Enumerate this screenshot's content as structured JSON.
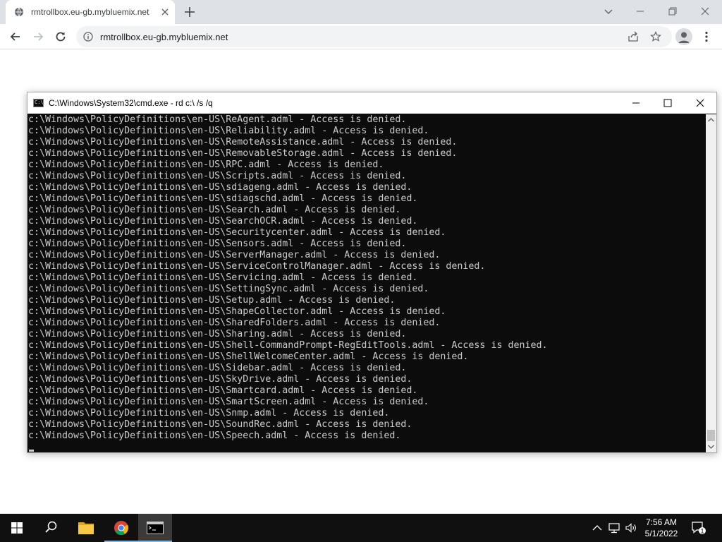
{
  "browser": {
    "tab_title": "rmtrollbox.eu-gb.mybluemix.net",
    "url": "rmtrollbox.eu-gb.mybluemix.net"
  },
  "cmd": {
    "title": "C:\\Windows\\System32\\cmd.exe - rd  c:\\ /s /q",
    "icon_text": "C:\\_",
    "lines": [
      "c:\\Windows\\PolicyDefinitions\\en-US\\ReAgent.adml - Access is denied.",
      "c:\\Windows\\PolicyDefinitions\\en-US\\Reliability.adml - Access is denied.",
      "c:\\Windows\\PolicyDefinitions\\en-US\\RemoteAssistance.adml - Access is denied.",
      "c:\\Windows\\PolicyDefinitions\\en-US\\RemovableStorage.adml - Access is denied.",
      "c:\\Windows\\PolicyDefinitions\\en-US\\RPC.adml - Access is denied.",
      "c:\\Windows\\PolicyDefinitions\\en-US\\Scripts.adml - Access is denied.",
      "c:\\Windows\\PolicyDefinitions\\en-US\\sdiageng.adml - Access is denied.",
      "c:\\Windows\\PolicyDefinitions\\en-US\\sdiagschd.adml - Access is denied.",
      "c:\\Windows\\PolicyDefinitions\\en-US\\Search.adml - Access is denied.",
      "c:\\Windows\\PolicyDefinitions\\en-US\\SearchOCR.adml - Access is denied.",
      "c:\\Windows\\PolicyDefinitions\\en-US\\Securitycenter.adml - Access is denied.",
      "c:\\Windows\\PolicyDefinitions\\en-US\\Sensors.adml - Access is denied.",
      "c:\\Windows\\PolicyDefinitions\\en-US\\ServerManager.adml - Access is denied.",
      "c:\\Windows\\PolicyDefinitions\\en-US\\ServiceControlManager.adml - Access is denied.",
      "c:\\Windows\\PolicyDefinitions\\en-US\\Servicing.adml - Access is denied.",
      "c:\\Windows\\PolicyDefinitions\\en-US\\SettingSync.adml - Access is denied.",
      "c:\\Windows\\PolicyDefinitions\\en-US\\Setup.adml - Access is denied.",
      "c:\\Windows\\PolicyDefinitions\\en-US\\ShapeCollector.adml - Access is denied.",
      "c:\\Windows\\PolicyDefinitions\\en-US\\SharedFolders.adml - Access is denied.",
      "c:\\Windows\\PolicyDefinitions\\en-US\\Sharing.adml - Access is denied.",
      "c:\\Windows\\PolicyDefinitions\\en-US\\Shell-CommandPrompt-RegEditTools.adml - Access is denied.",
      "c:\\Windows\\PolicyDefinitions\\en-US\\ShellWelcomeCenter.adml - Access is denied.",
      "c:\\Windows\\PolicyDefinitions\\en-US\\Sidebar.adml - Access is denied.",
      "c:\\Windows\\PolicyDefinitions\\en-US\\SkyDrive.adml - Access is denied.",
      "c:\\Windows\\PolicyDefinitions\\en-US\\Smartcard.adml - Access is denied.",
      "c:\\Windows\\PolicyDefinitions\\en-US\\SmartScreen.adml - Access is denied.",
      "c:\\Windows\\PolicyDefinitions\\en-US\\Snmp.adml - Access is denied.",
      "c:\\Windows\\PolicyDefinitions\\en-US\\SoundRec.adml - Access is denied.",
      "c:\\Windows\\PolicyDefinitions\\en-US\\Speech.adml - Access is denied."
    ]
  },
  "taskbar": {
    "time": "7:56 AM",
    "date": "5/1/2022",
    "notification_count": "1"
  },
  "colors": {
    "console_bg": "#0c0c0c",
    "console_text": "#cccccc",
    "taskbar_bg": "#101010",
    "tabstrip_bg": "#dee1e6"
  }
}
